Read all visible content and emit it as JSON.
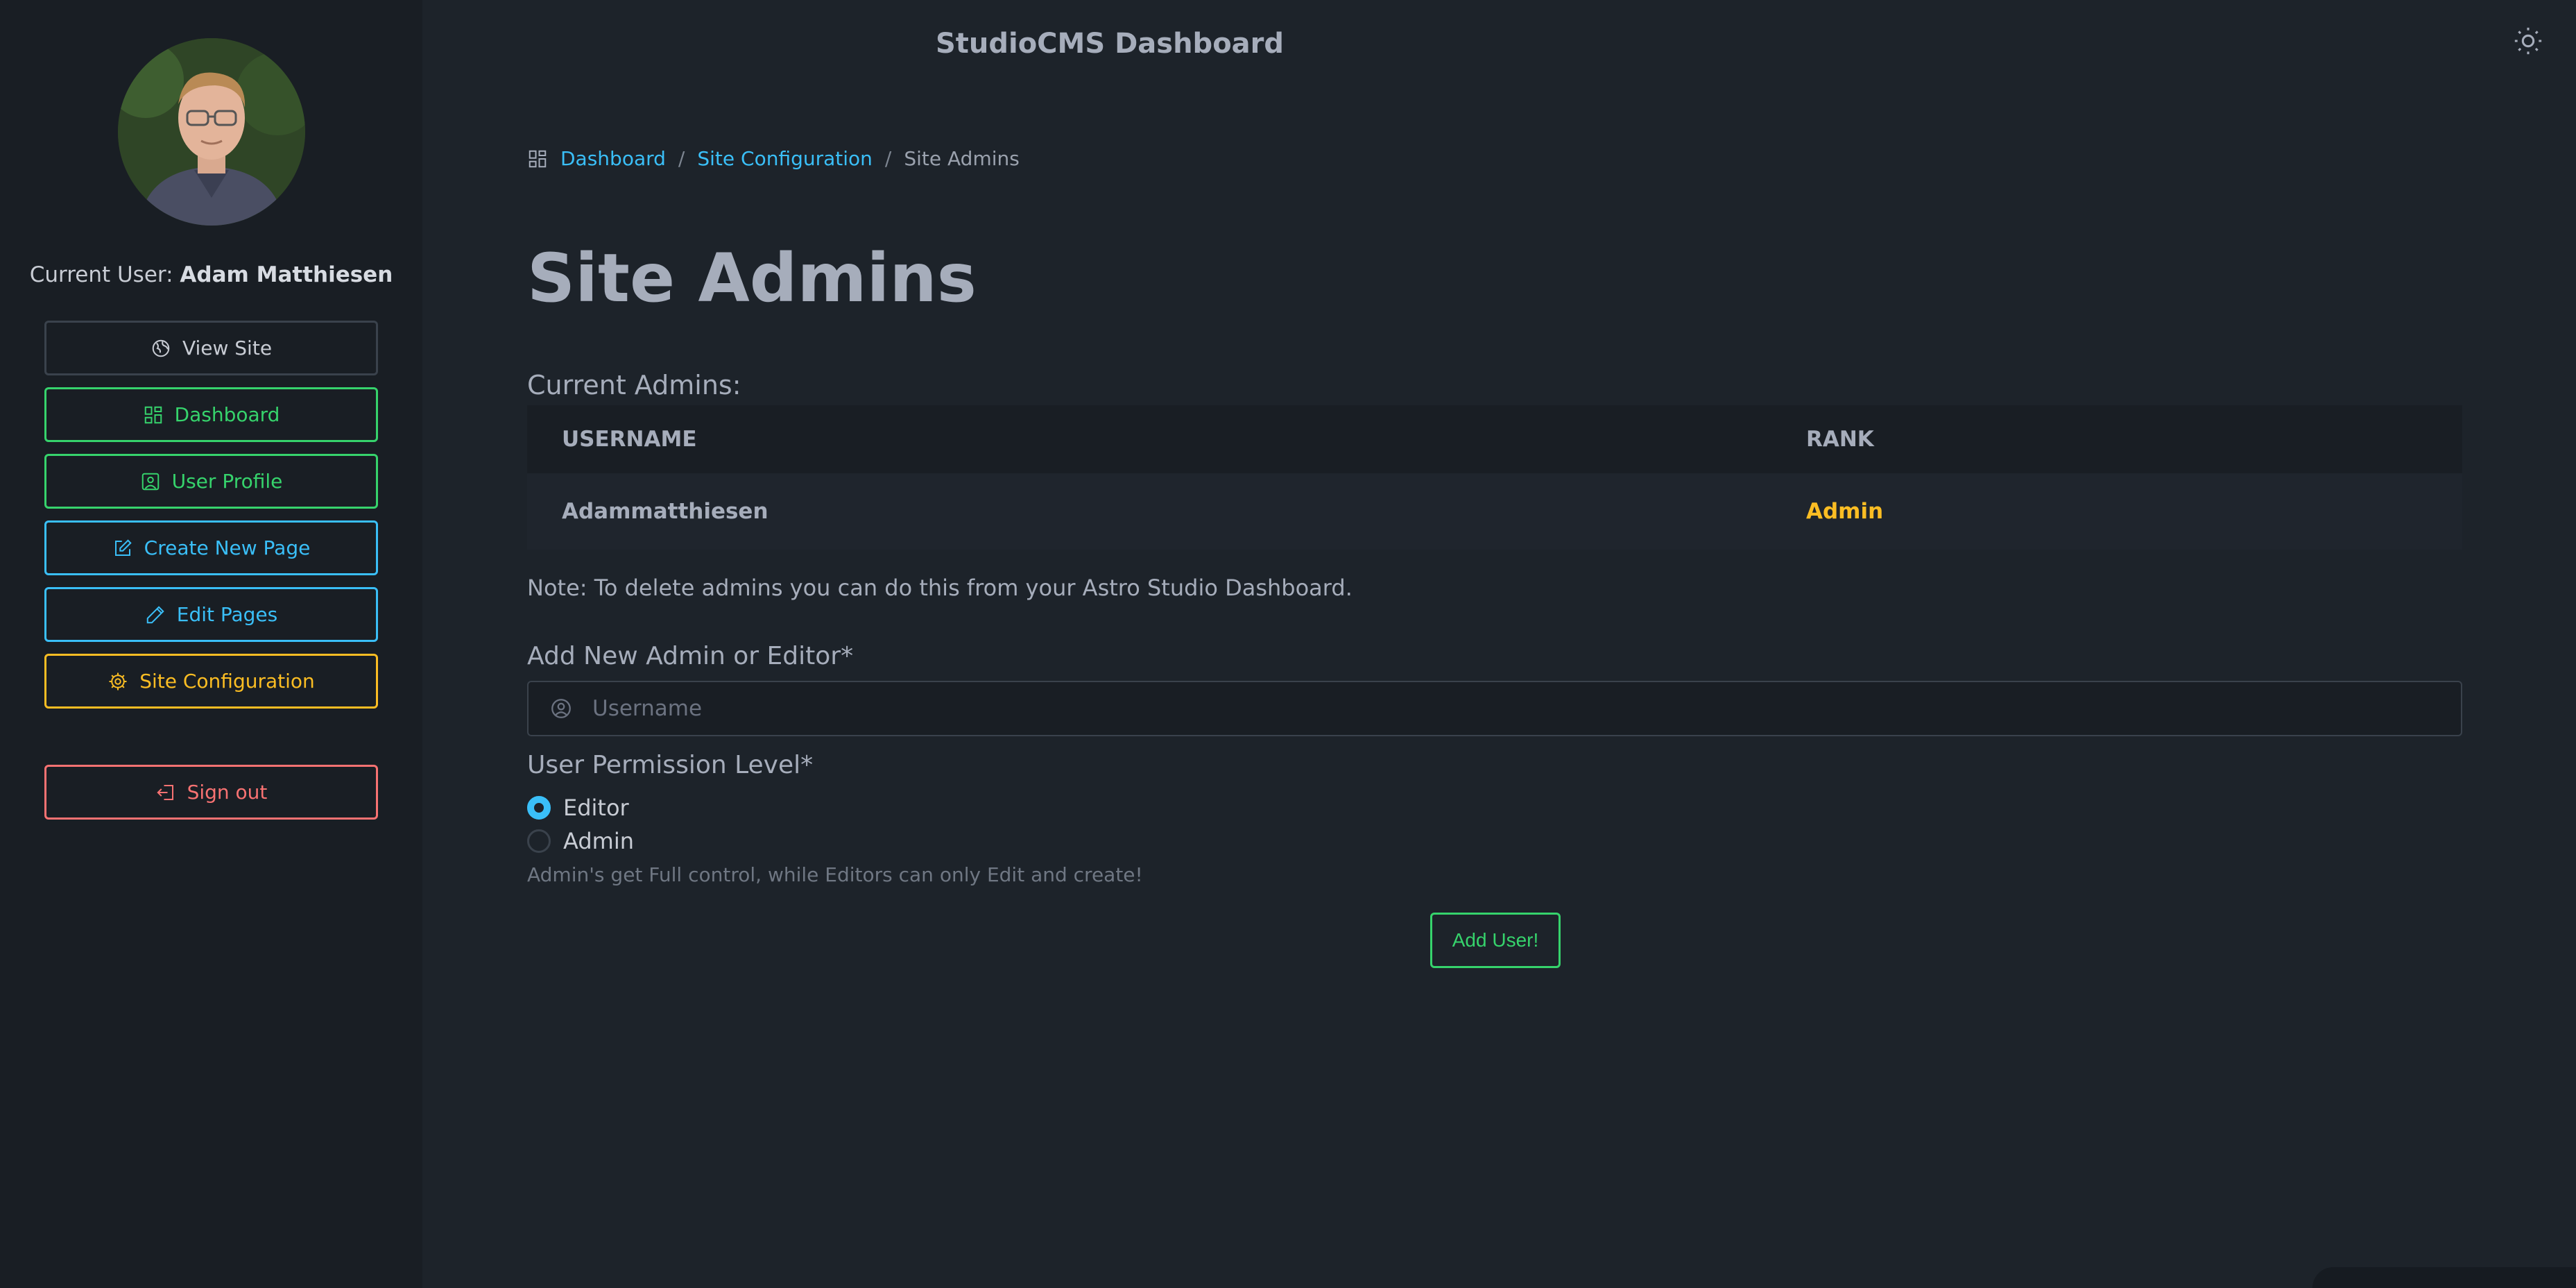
{
  "header": {
    "title": "StudioCMS Dashboard"
  },
  "sidebar": {
    "current_user_prefix": "Current User:",
    "current_user_name": "Adam Matthiesen",
    "items": [
      {
        "label": "View Site",
        "icon": "globe-icon",
        "color": "#c8ccd4"
      },
      {
        "label": "Dashboard",
        "icon": "dashboard-icon",
        "color": "#36d36c"
      },
      {
        "label": "User Profile",
        "icon": "user-profile-icon",
        "color": "#36d36c"
      },
      {
        "label": "Create New Page",
        "icon": "edit-square-icon",
        "color": "#3abff8"
      },
      {
        "label": "Edit Pages",
        "icon": "pencil-icon",
        "color": "#3abff8"
      },
      {
        "label": "Site Configuration",
        "icon": "gear-icon",
        "color": "#fbbd23"
      }
    ],
    "sign_out": {
      "label": "Sign out",
      "icon": "sign-out-icon",
      "color": "#f87272"
    }
  },
  "breadcrumb": {
    "items": [
      "Dashboard",
      "Site Configuration"
    ],
    "current": "Site Admins",
    "separator": "/"
  },
  "page_title": "Site Admins",
  "admins": {
    "label": "Current Admins:",
    "columns": [
      "USERNAME",
      "RANK"
    ],
    "rows": [
      {
        "username": "Adammatthiesen",
        "rank": "Admin"
      }
    ]
  },
  "note": "Note: To delete admins you can do this from your Astro Studio Dashboard.",
  "form": {
    "add_label": "Add New Admin or Editor",
    "required_mark": "*",
    "username_placeholder": "Username",
    "username_value": "",
    "permission_label": "User Permission Level",
    "options": [
      {
        "label": "Editor",
        "checked": true
      },
      {
        "label": "Admin",
        "checked": false
      }
    ],
    "hint": "Admin's get Full control, while Editors can only Edit and create!",
    "submit_label": "Add User!"
  },
  "colors": {
    "accent_blue": "#3abff8",
    "accent_green": "#36d36c",
    "accent_yellow": "#fbbd23",
    "accent_red": "#f87272"
  }
}
